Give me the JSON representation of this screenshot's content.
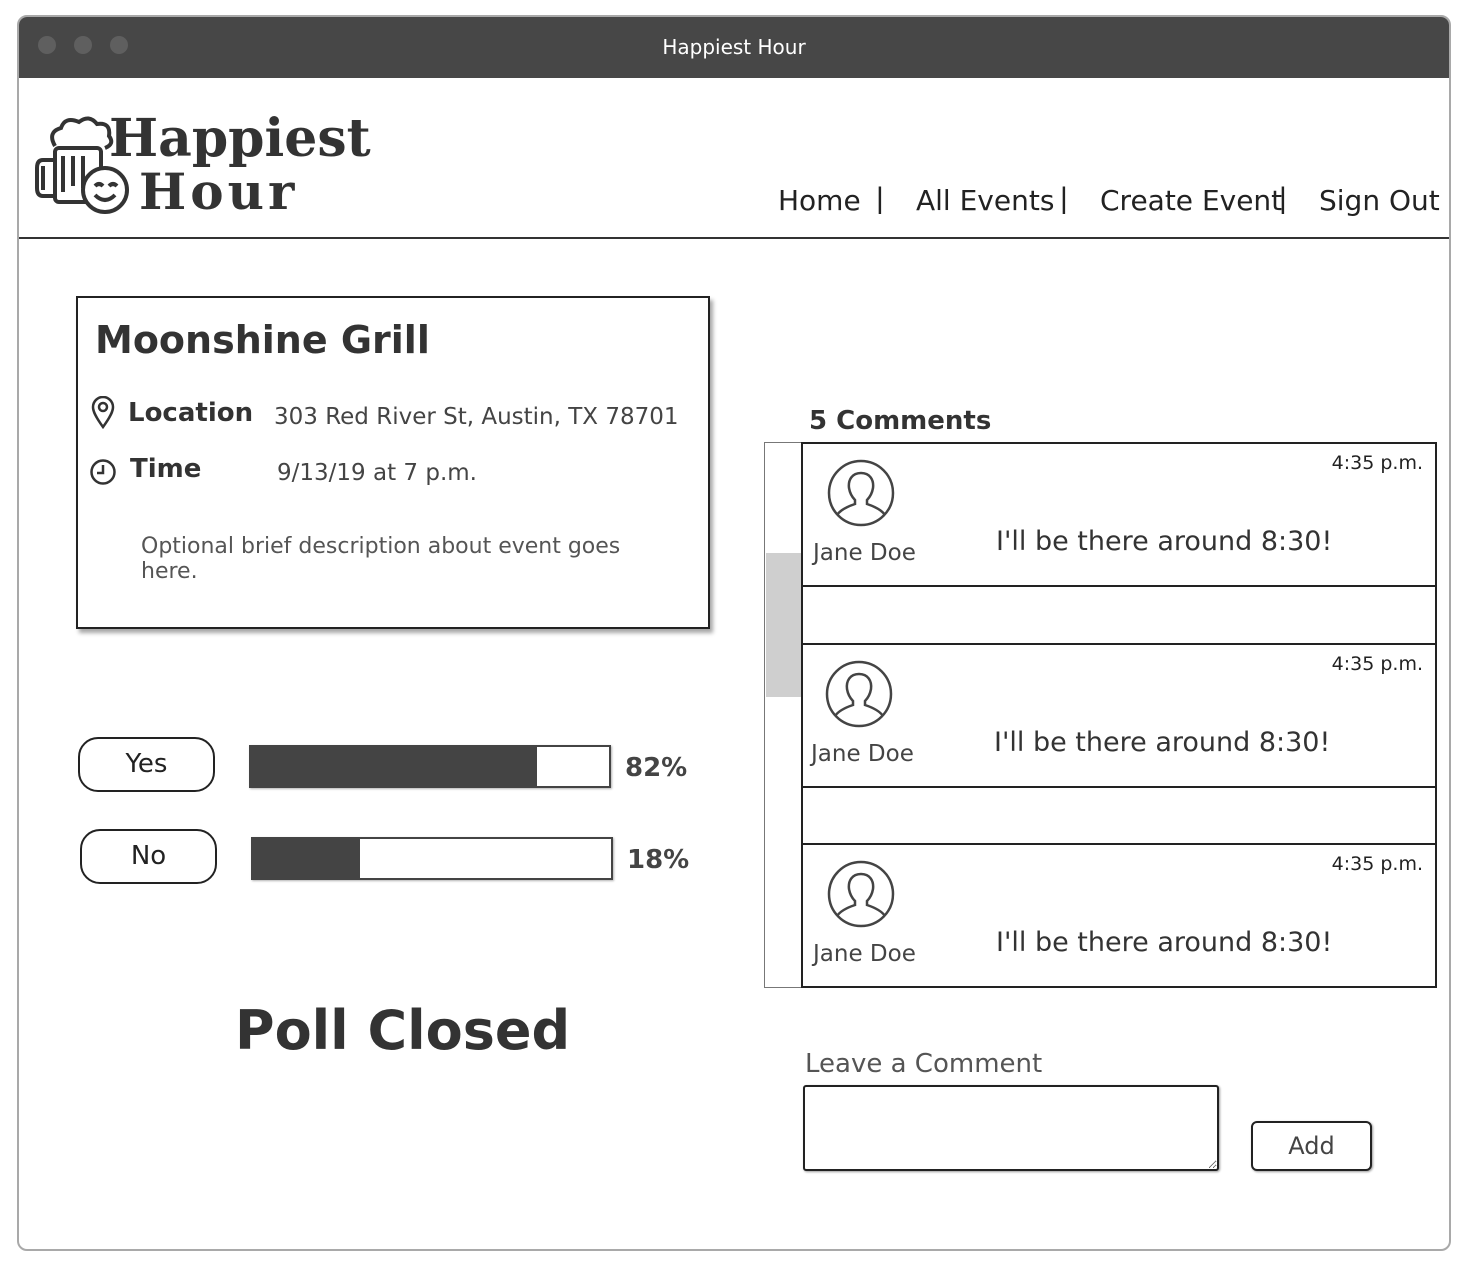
{
  "window": {
    "title": "Happiest Hour"
  },
  "header": {
    "logo": {
      "line1": "Happiest",
      "line2": "Hour",
      "icon": "beer-mug-smiley-icon"
    },
    "nav": [
      {
        "label": "Home"
      },
      {
        "label": "All Events"
      },
      {
        "label": "Create Event"
      },
      {
        "label": "Sign Out"
      }
    ],
    "separator": "|"
  },
  "event": {
    "name": "Moonshine Grill",
    "location_label": "Location",
    "location_value": "303 Red River St, Austin, TX 78701",
    "time_label": "Time",
    "time_value": "9/13/19 at 7 p.m.",
    "description": "Optional brief description about event goes here."
  },
  "poll": {
    "options": [
      {
        "label": "Yes",
        "percent_text": "82%",
        "fill_fraction": 0.8
      },
      {
        "label": "No",
        "percent_text": "18%",
        "fill_fraction": 0.3
      }
    ],
    "status": "Poll Closed"
  },
  "comments": {
    "heading": "5 Comments",
    "items": [
      {
        "author": "Jane Doe",
        "text": "I'll be there around 8:30!",
        "time": "4:35 p.m."
      },
      {
        "author": "Jane Doe",
        "text": "I'll be there around 8:30!",
        "time": "4:35 p.m."
      },
      {
        "author": "Jane Doe",
        "text": "I'll be there around 8:30!",
        "time": "4:35 p.m."
      }
    ],
    "leave_label": "Leave a Comment",
    "input_value": "",
    "add_label": "Add"
  },
  "colors": {
    "titlebar": "#474747",
    "bar_fill": "#444444",
    "scroll_thumb": "#cfcfcf"
  }
}
